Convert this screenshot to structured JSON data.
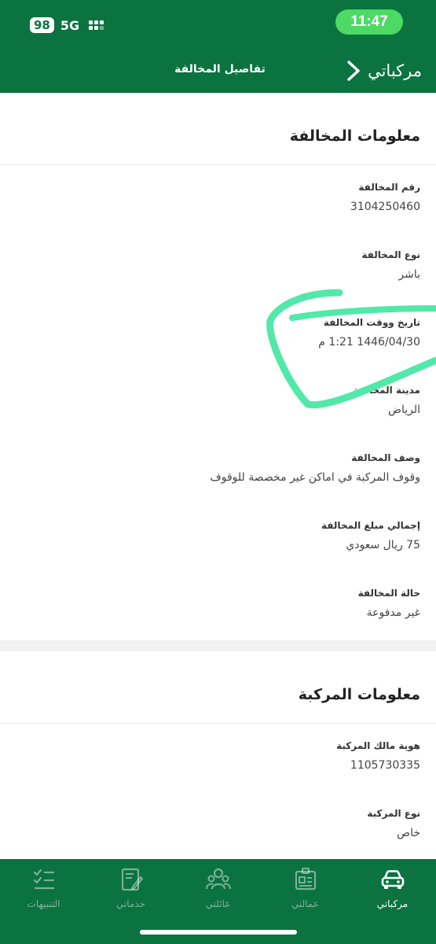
{
  "status_bar": {
    "battery": "98",
    "network": "5G",
    "time": "11:47"
  },
  "nav": {
    "title": "تفاصيل المخالفة",
    "back_label": "مركباتي"
  },
  "violation_section": {
    "title": "معلومات المخالفة",
    "fields": [
      {
        "label": "رقم المخالفة",
        "value": "3104250460"
      },
      {
        "label": "نوع المخالفة",
        "value": "باشر"
      },
      {
        "label": "تاريخ ووقت المخالفة",
        "value": "1446/04/30 1:21 م"
      },
      {
        "label": "مدينة المخالفة",
        "value": "الرياض"
      },
      {
        "label": "وصف المخالفة",
        "value": "وقوف المركبة في اماكن غير مخصصة للوقوف"
      },
      {
        "label": "إجمالي مبلغ المخالفة",
        "value": "75 ريال سعودي"
      },
      {
        "label": "حالة المخالفة",
        "value": "غير مدفوعة"
      }
    ]
  },
  "vehicle_section": {
    "title": "معلومات المركبة",
    "fields": [
      {
        "label": "هوية مالك المركبة",
        "value": "1105730335"
      },
      {
        "label": "نوع المركبة",
        "value": "خاص"
      }
    ]
  },
  "tabbar": {
    "tabs": [
      {
        "label": "مركباتي",
        "icon": "car-icon",
        "active": true
      },
      {
        "label": "عمالتي",
        "icon": "id-card-icon",
        "active": false
      },
      {
        "label": "عائلتي",
        "icon": "family-icon",
        "active": false
      },
      {
        "label": "خدماتي",
        "icon": "edit-document-icon",
        "active": false
      },
      {
        "label": "التنبيهات",
        "icon": "checklist-icon",
        "active": false
      }
    ]
  },
  "colors": {
    "brand_green": "#0a7340",
    "clock_green": "#4cd964",
    "highlight_stroke": "#4de6a6"
  }
}
